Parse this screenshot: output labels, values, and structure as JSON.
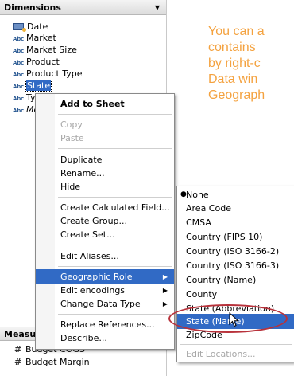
{
  "dimensions_pane": {
    "header": "Dimensions",
    "fields": [
      {
        "icon": "date-icon",
        "label": "Date"
      },
      {
        "icon": "Abc",
        "label": "Market"
      },
      {
        "icon": "Abc",
        "label": "Market Size"
      },
      {
        "icon": "Abc",
        "label": "Product"
      },
      {
        "icon": "Abc",
        "label": "Product Type"
      },
      {
        "icon": "Abc",
        "label": "State"
      },
      {
        "icon": "Abc",
        "label": "Type"
      },
      {
        "icon": "Abc",
        "label": "Mea"
      }
    ]
  },
  "measures_pane": {
    "header": "Measure",
    "fields": [
      {
        "icon": "#",
        "label": "Budget COGS"
      },
      {
        "icon": "#",
        "label": "Budget Margin"
      }
    ]
  },
  "help_text": {
    "line1": "You can a",
    "line2": "contains",
    "line3": "by right-c",
    "line4": "Data win",
    "line5": "Geograph"
  },
  "context_menu": {
    "items": [
      {
        "label": "Add to Sheet",
        "bold": true
      },
      {
        "label": "Copy",
        "disabled": true
      },
      {
        "label": "Paste",
        "disabled": true
      },
      {
        "label": "Duplicate"
      },
      {
        "label": "Rename..."
      },
      {
        "label": "Hide"
      },
      {
        "label": "Create Calculated Field..."
      },
      {
        "label": "Create Group..."
      },
      {
        "label": "Create Set..."
      },
      {
        "label": "Edit Aliases..."
      },
      {
        "label": "Geographic Role",
        "submenu": true,
        "highlighted": true
      },
      {
        "label": "Edit encodings",
        "submenu": true
      },
      {
        "label": "Change Data Type",
        "submenu": true
      },
      {
        "label": "Replace References..."
      },
      {
        "label": "Describe..."
      }
    ]
  },
  "geo_submenu": {
    "items": [
      {
        "label": "None",
        "checked": true
      },
      {
        "label": "Area Code"
      },
      {
        "label": "CMSA"
      },
      {
        "label": "Country (FIPS 10)"
      },
      {
        "label": "Country (ISO 3166-2)"
      },
      {
        "label": "Country (ISO 3166-3)"
      },
      {
        "label": "Country (Name)"
      },
      {
        "label": "County"
      },
      {
        "label": "State (Abbreviation)"
      },
      {
        "label": "State (Name)",
        "highlighted": true
      },
      {
        "label": "ZipCode"
      },
      {
        "label": "Edit Locations...",
        "disabled": true
      }
    ]
  },
  "colors": {
    "accent_text": "#f4a23f",
    "selection": "#316ac5",
    "callout": "#b8323b"
  }
}
